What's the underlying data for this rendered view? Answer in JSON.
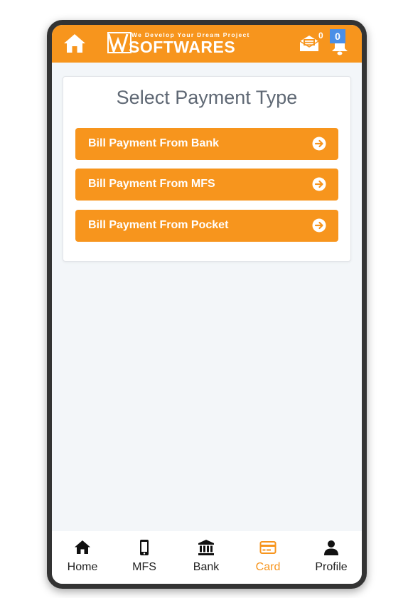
{
  "header": {
    "logo_tagline": "We Develop Your Dream Project",
    "logo_text": "SOFTWARES",
    "message_count": "0",
    "notification_count": "0",
    "icons": [
      "home-icon",
      "envelope-icon",
      "bell-icon"
    ]
  },
  "main": {
    "title": "Select Payment Type",
    "options": [
      {
        "label": "Bill Payment From Bank"
      },
      {
        "label": "Bill Payment From MFS"
      },
      {
        "label": "Bill Payment From Pocket"
      }
    ]
  },
  "bottom_nav": {
    "items": [
      {
        "label": "Home",
        "icon": "home-icon"
      },
      {
        "label": "MFS",
        "icon": "mobile-icon"
      },
      {
        "label": "Bank",
        "icon": "bank-icon"
      },
      {
        "label": "Card",
        "icon": "credit-card-icon",
        "active": true
      },
      {
        "label": "Profile",
        "icon": "user-icon"
      }
    ]
  },
  "colors": {
    "brand": "#f7951d",
    "frame": "#333333",
    "background": "#f3f6f9",
    "badge": "#4a8fe7"
  }
}
